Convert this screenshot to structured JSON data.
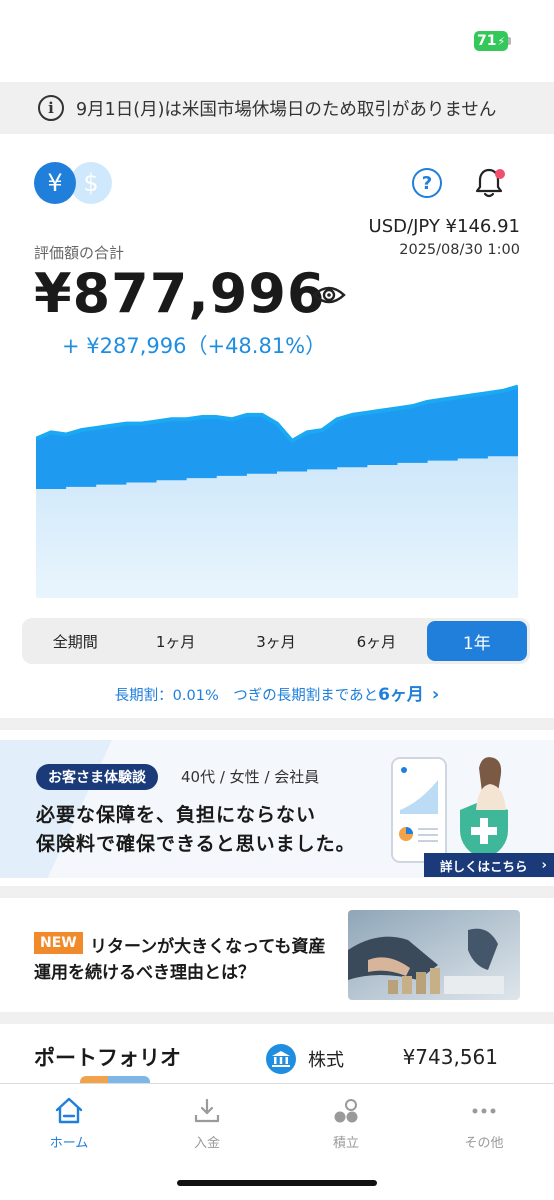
{
  "status": {
    "battery": "71"
  },
  "notice": {
    "text": "9月1日(月)は米国市場休場日のため取引がありません"
  },
  "currency": {
    "yen_symbol": "¥",
    "usd_symbol": "$"
  },
  "fx": {
    "rate": "USD/JPY ¥146.91",
    "time": "2025/08/30 1:00"
  },
  "summary": {
    "label": "評価額の合計",
    "total": "¥877,996",
    "gain": "+ ¥287,996（+48.81%）"
  },
  "chart_data": {
    "type": "area",
    "title": "",
    "xlabel": "",
    "ylabel": "",
    "period": "1年",
    "series": [
      {
        "role": "evaluation",
        "color": "#1e9bf0",
        "values": [
          0.73,
          0.76,
          0.75,
          0.77,
          0.78,
          0.79,
          0.8,
          0.8,
          0.81,
          0.82,
          0.82,
          0.83,
          0.83,
          0.82,
          0.84,
          0.84,
          0.8,
          0.72,
          0.76,
          0.77,
          0.82,
          0.84,
          0.85,
          0.86,
          0.87,
          0.88,
          0.9,
          0.91,
          0.92,
          0.93,
          0.94,
          0.95,
          0.97
        ]
      },
      {
        "role": "contributions",
        "color": "#d6ecfb",
        "values": [
          0.5,
          0.5,
          0.51,
          0.51,
          0.52,
          0.52,
          0.53,
          0.53,
          0.54,
          0.54,
          0.55,
          0.55,
          0.56,
          0.56,
          0.57,
          0.57,
          0.58,
          0.58,
          0.59,
          0.59,
          0.6,
          0.6,
          0.61,
          0.61,
          0.62,
          0.62,
          0.63,
          0.63,
          0.64,
          0.64,
          0.65,
          0.65,
          0.66
        ]
      }
    ]
  },
  "periods": {
    "items": [
      "全期間",
      "1ヶ月",
      "3ヶ月",
      "6ヶ月",
      "1年"
    ],
    "active_index": 4
  },
  "long_discount": {
    "prefix": "長期割：0.01%　つぎの長期割まであと",
    "months": "6ヶ月"
  },
  "banner": {
    "badge": "お客さま体験談",
    "meta": "40代 / 女性 / 会社員",
    "line1": "必要な保障を、負担にならない",
    "line2": "保険料で確保できると思いました。",
    "cta": "詳しくはこちら"
  },
  "article": {
    "badge": "NEW",
    "line1": "リターンが大きくなっても資産",
    "line2": "運用を続けるべき理由とは？"
  },
  "portfolio": {
    "title": "ポートフォリオ",
    "stock_label": "株式",
    "stock_value": "¥743,561"
  },
  "tabs": [
    {
      "label": "ホーム",
      "icon": "home-icon"
    },
    {
      "label": "入金",
      "icon": "deposit-icon"
    },
    {
      "label": "積立",
      "icon": "savings-icon"
    },
    {
      "label": "その他",
      "icon": "more-icon"
    }
  ]
}
